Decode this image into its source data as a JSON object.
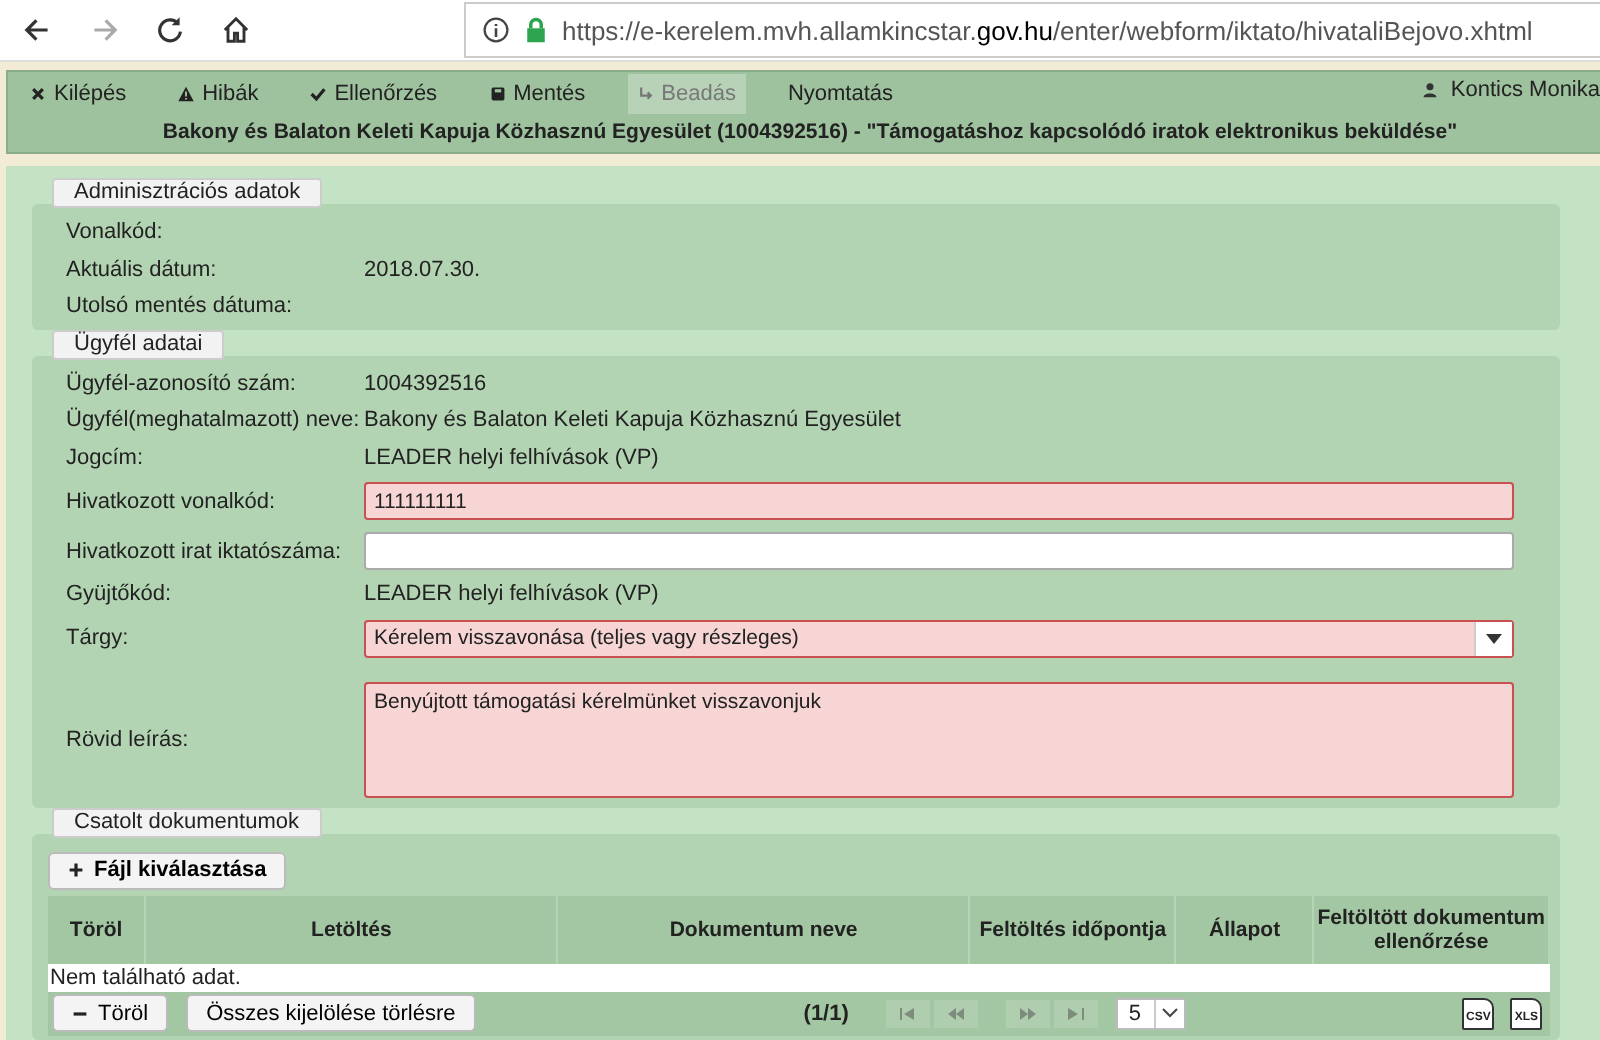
{
  "browser": {
    "url": "https://e-kerelem.mvh.allamkincstar.**gov.hu**/enter/webform/iktato/hivataliBejovo.xhtml",
    "forward_disabled": true
  },
  "toolbar": {
    "items": [
      {
        "label": "Kilépés",
        "disabled": false
      },
      {
        "label": "Hibák",
        "disabled": false
      },
      {
        "label": "Ellenőrzés",
        "disabled": false
      },
      {
        "label": "Mentés",
        "disabled": false
      },
      {
        "label": "Beadás",
        "disabled": true
      },
      {
        "label": "Nyomtatás",
        "disabled": false
      }
    ],
    "user": "Kontics Monika",
    "title": "Bakony és Balaton Keleti Kapuja Közhasznú Egyesület (1004392516) - \"Támogatáshoz kapcsolódó iratok elektronikus beküldése\""
  },
  "sections": [
    {
      "legend": "Adminisztrációs adatok",
      "fields": [
        {
          "kind": "text",
          "label": "Vonalkód:"
        },
        {
          "kind": "text",
          "label": "Aktuális dátum:",
          "value": "2018.07.30."
        },
        {
          "kind": "text",
          "label": "Utolsó mentés dátuma:"
        }
      ]
    },
    {
      "legend": "Ügyfél adatai",
      "fields": [
        {
          "kind": "text",
          "label": "Ügyfél-azonosító szám:",
          "value": "1004392516"
        },
        {
          "kind": "text",
          "label": "Ügyfél(meghatalmazott) neve:",
          "value": "Bakony és Balaton Keleti Kapuja Közhasznú Egyesület"
        },
        {
          "kind": "text",
          "label": "Jogcím:",
          "value": "LEADER helyi felhívások (VP)"
        },
        {
          "kind": "input",
          "label": "Hivatkozott vonalkód:",
          "value": "111111111",
          "invalid": true
        },
        {
          "kind": "input",
          "label": "Hivatkozott irat iktatószáma:",
          "invalid": false
        },
        {
          "kind": "text",
          "label": "Gyüjtőkód:",
          "value": "LEADER helyi felhívások (VP)"
        },
        {
          "kind": "select",
          "label": "Tárgy:",
          "value": "Kérelem visszavonása (teljes vagy részleges)",
          "invalid": true
        },
        {
          "kind": "textarea",
          "label": "Rövid leírás:",
          "value": "Benyújtott támogatási kérelmünket visszavonjuk",
          "invalid": true
        }
      ]
    }
  ],
  "documents": {
    "legend": "Csatolt dokumentumok",
    "upload_button": "Fájl kiválasztása",
    "columns": [
      "Töröl",
      "Letöltés",
      "Dokumentum neve",
      "Feltöltés időpontja",
      "Állapot",
      "Feltöltött dokumentum ellenőrzése"
    ],
    "empty": "Nem található adat.",
    "delete_button": "Töröl",
    "clear_button": "Összes kijelölése törlésre",
    "page": "(1/1)",
    "pager": [
      {
        "kind": "first",
        "disabled": true
      },
      {
        "kind": "prev",
        "disabled": true
      },
      {
        "kind": "next",
        "disabled": true
      },
      {
        "kind": "last",
        "disabled": true
      }
    ],
    "page_size": "5",
    "exports": [
      "CSV",
      "XLS"
    ]
  }
}
